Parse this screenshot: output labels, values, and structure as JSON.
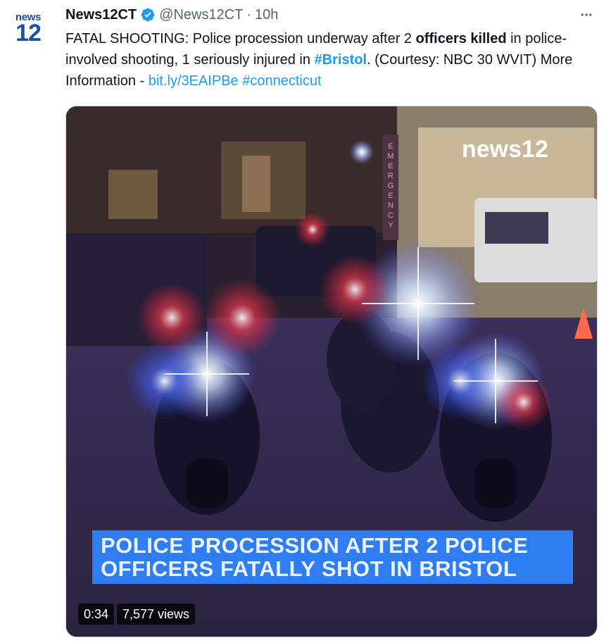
{
  "avatar": {
    "line1": "news",
    "line2": "12"
  },
  "author": {
    "name": "News12CT",
    "handle": "@News12CT",
    "separator": "·",
    "time": "10h",
    "verified_icon": "verified-badge-icon",
    "verified_color": "#1d9bf0"
  },
  "more_icon": "more-horizontal-icon",
  "tweet": {
    "part1": "FATAL SHOOTING: Police procession underway after 2 ",
    "bold1": "officers killed",
    "part2": " in police-involved shooting, 1 seriously injured in ",
    "hashtag1": "#Bristol",
    "part3": ". (Courtesy: NBC 30 WVIT) More Information - ",
    "link": "bit.ly/3EAIPBe",
    "space": " ",
    "hashtag2": "#connecticut"
  },
  "video": {
    "sign_text": "news12",
    "vertical_sign": "EMERGENCY",
    "caption_line1": "POLICE PROCESSION AFTER 2 POLICE",
    "caption_line2": "OFFICERS FATALLY SHOT IN BRISTOL",
    "duration": "0:34",
    "views": "7,577 views"
  },
  "colors": {
    "link": "#1d9bf0",
    "caption_bg": "#2f7df2",
    "brand_blue": "#1d4fa3"
  }
}
